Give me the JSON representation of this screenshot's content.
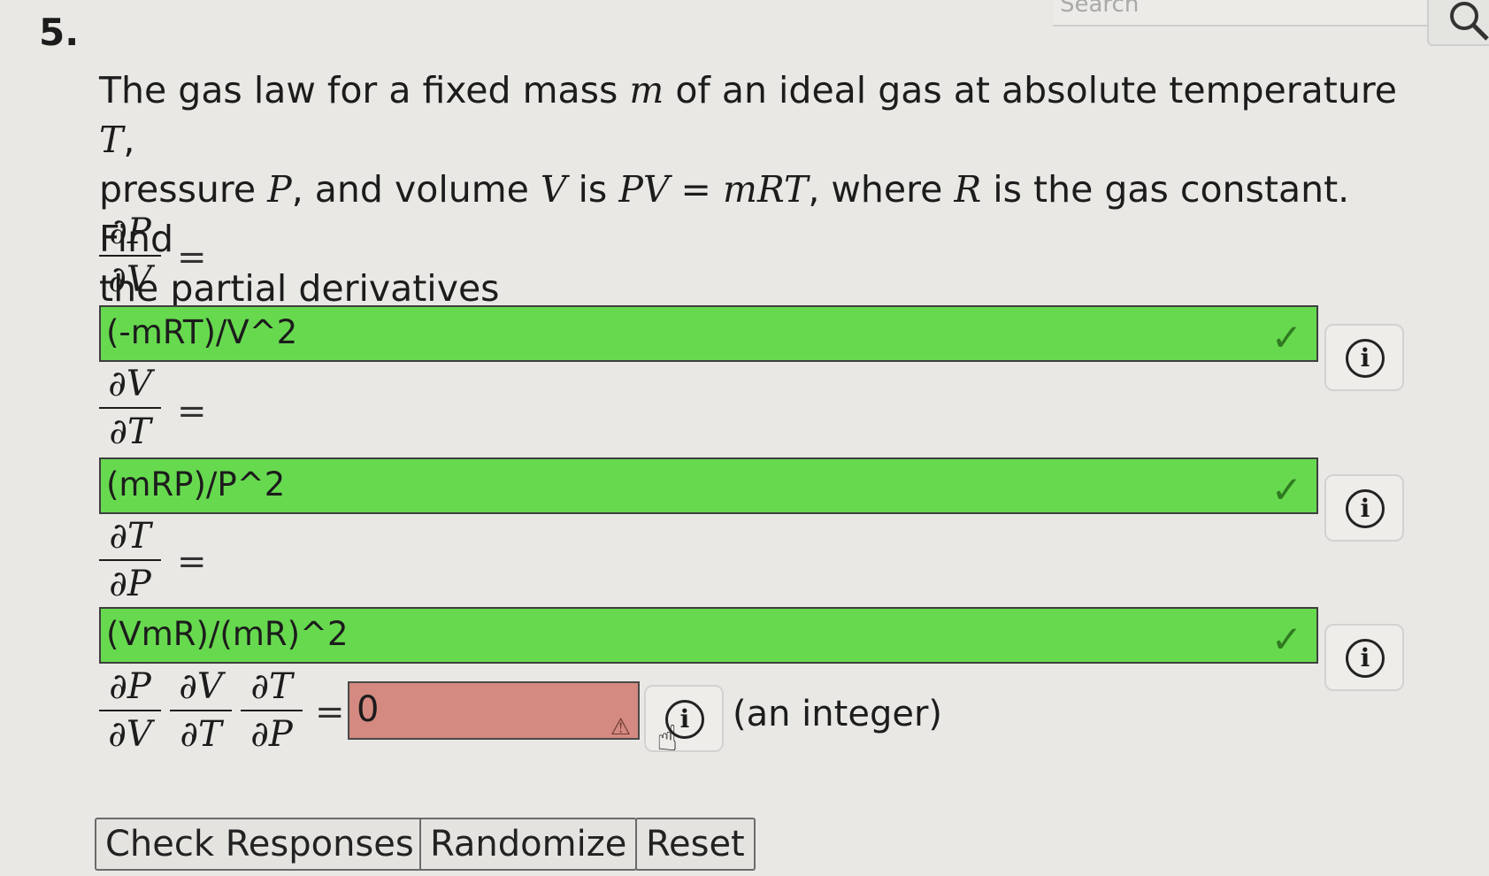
{
  "question_number": "5.",
  "search": {
    "placeholder": "Search"
  },
  "prompt": {
    "text1": "The gas law for a fixed mass ",
    "m": "m",
    "text2": " of an ideal gas at absolute temperature ",
    "T": "T",
    "text3": ",",
    "text4": "pressure ",
    "P": "P",
    "text5": ", and volume ",
    "V": "V",
    "text6": " is ",
    "equation": "PV = mRT",
    "text7": ", where ",
    "R": "R",
    "text8": " is the gas constant. Find",
    "text9": "the partial derivatives"
  },
  "parts": [
    {
      "num": "∂P",
      "den": "∂V",
      "eq": "=",
      "answer": "(-mRT)/V^2",
      "status": "correct"
    },
    {
      "num": "∂V",
      "den": "∂T",
      "eq": "=",
      "answer": "(mRP)/P^2",
      "status": "correct"
    },
    {
      "num": "∂T",
      "den": "∂P",
      "eq": "=",
      "answer": "(VmR)/(mR)^2",
      "status": "correct"
    }
  ],
  "product": {
    "fractions": [
      {
        "num": "∂P",
        "den": "∂V"
      },
      {
        "num": "∂V",
        "den": "∂T"
      },
      {
        "num": "∂T",
        "den": "∂P"
      }
    ],
    "eq": "=",
    "answer": "0",
    "status": "incorrect",
    "hint": "(an integer)"
  },
  "icons": {
    "check": "✓",
    "info": "i",
    "warning": "⚠",
    "cursor": "☝"
  },
  "buttons": {
    "check": "Check Responses",
    "randomize": "Randomize",
    "reset": "Reset"
  }
}
